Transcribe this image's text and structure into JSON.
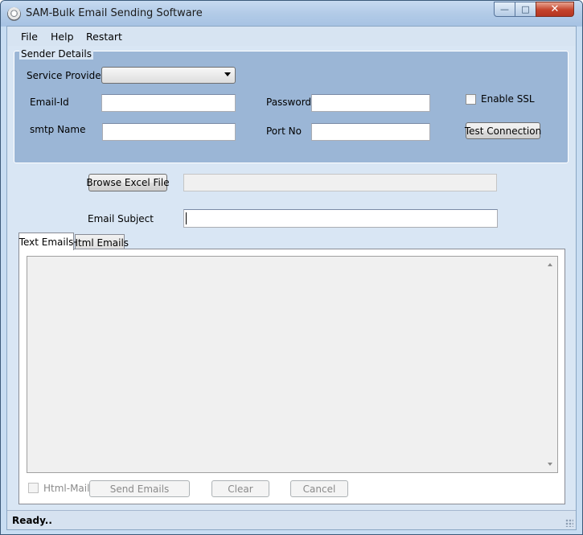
{
  "window": {
    "title": "SAM-Bulk Email Sending Software"
  },
  "menu": {
    "items": [
      "File",
      "Help",
      "Restart"
    ]
  },
  "sender": {
    "group_title": "Sender Details",
    "service_provider_label": "Service Provider",
    "service_provider_value": "",
    "email_label": "Email-Id",
    "email_value": "",
    "password_label": "Password",
    "password_value": "",
    "smtp_label": "smtp Name",
    "smtp_value": "",
    "port_label": "Port No",
    "port_value": "",
    "ssl_label": "Enable SSL",
    "ssl_checked": false,
    "test_button": "Test Connection"
  },
  "file": {
    "browse_button": "Browse Excel File",
    "path_value": ""
  },
  "subject": {
    "label": "Email Subject",
    "value": ""
  },
  "tabs": [
    {
      "label": "Text Emails",
      "active": true
    },
    {
      "label": "Html Emails",
      "active": false
    }
  ],
  "footer": {
    "html_mail_label": "Html-Mail",
    "send_button": "Send Emails",
    "clear_button": "Clear",
    "cancel_button": "Cancel"
  },
  "status": {
    "text": "Ready.."
  }
}
